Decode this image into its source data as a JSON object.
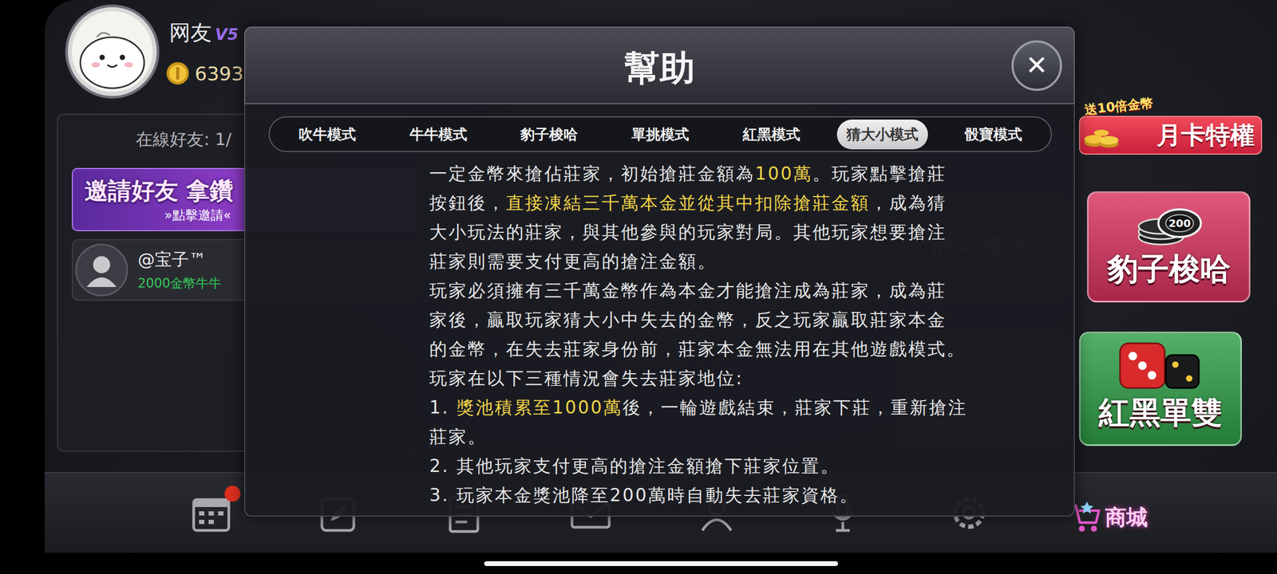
{
  "player": {
    "name": "网友",
    "vip": "V5",
    "coins": "6393"
  },
  "friends_panel": {
    "online": "在線好友: 1/",
    "invite": {
      "title": "邀請好友 拿鑽",
      "subtitle": "»點擊邀請«"
    },
    "friends": [
      {
        "name": "@宝子™",
        "status": "2000金幣牛牛"
      }
    ]
  },
  "background_card": {
    "label": "吹牛模式"
  },
  "promo": {
    "badge": "送10倍金幣",
    "title": "月卡特權"
  },
  "chip": {
    "label": "200"
  },
  "mode_buttons": [
    {
      "label": "豹子梭哈",
      "color": "#d9325e"
    },
    {
      "label": "紅黑單雙",
      "color": "#2e9f47"
    }
  ],
  "nav": {
    "items": [
      {
        "badge": true
      },
      {
        "badge": false
      },
      {
        "badge": false
      },
      {
        "badge": false
      },
      {
        "badge": false
      },
      {
        "badge": false
      },
      {
        "badge": false
      }
    ],
    "shop": {
      "label": "商城"
    }
  },
  "dialog": {
    "title": "幫助",
    "close": "✕",
    "tabs": [
      {
        "label": "吹牛模式",
        "selected": false
      },
      {
        "label": "牛牛模式",
        "selected": false
      },
      {
        "label": "豹子梭哈",
        "selected": false
      },
      {
        "label": "單挑模式",
        "selected": false
      },
      {
        "label": "紅黑模式",
        "selected": false
      },
      {
        "label": "猜大小模式",
        "selected": true
      },
      {
        "label": "骰寶模式",
        "selected": false
      }
    ],
    "lines": [
      [
        {
          "text": "一定金幣來搶佔莊家，初始搶莊金額為",
          "highlight": false
        },
        {
          "text": "100萬",
          "highlight": true
        },
        {
          "text": "。玩家點擊搶莊",
          "highlight": false
        }
      ],
      [
        {
          "text": "按鈕後，",
          "highlight": false
        },
        {
          "text": "直接凍結三千萬本金並從其中扣除搶莊金額",
          "highlight": true
        },
        {
          "text": "，成為猜",
          "highlight": false
        }
      ],
      [
        {
          "text": "大小玩法的莊家，與其他參與的玩家對局。其他玩家想要搶注",
          "highlight": false
        }
      ],
      [
        {
          "text": "莊家則需要支付更高的搶注金額。",
          "highlight": false
        }
      ],
      [
        {
          "text": "玩家必須擁有三千萬金幣作為本金才能搶注成為莊家，成為莊",
          "highlight": false
        }
      ],
      [
        {
          "text": "家後，贏取玩家猜大小中失去的金幣，反之玩家贏取莊家本金",
          "highlight": false
        }
      ],
      [
        {
          "text": "的金幣，在失去莊家身份前，莊家本金無法用在其他遊戲模式。",
          "highlight": false
        }
      ],
      [
        {
          "text": "玩家在以下三種情況會失去莊家地位:",
          "highlight": false
        }
      ],
      [
        {
          "text": "1. ",
          "highlight": false
        },
        {
          "text": "獎池積累至1000萬",
          "highlight": true
        },
        {
          "text": "後，一輪遊戲結束，莊家下莊，重新搶注",
          "highlight": false
        }
      ],
      [
        {
          "text": "莊家。",
          "highlight": false
        }
      ],
      [
        {
          "text": "2. 其他玩家支付更高的搶注金額搶下莊家位置。",
          "highlight": false
        }
      ],
      [
        {
          "text": "3. 玩家本金獎池降至200萬時自動失去莊家資格。",
          "highlight": false
        }
      ]
    ]
  }
}
